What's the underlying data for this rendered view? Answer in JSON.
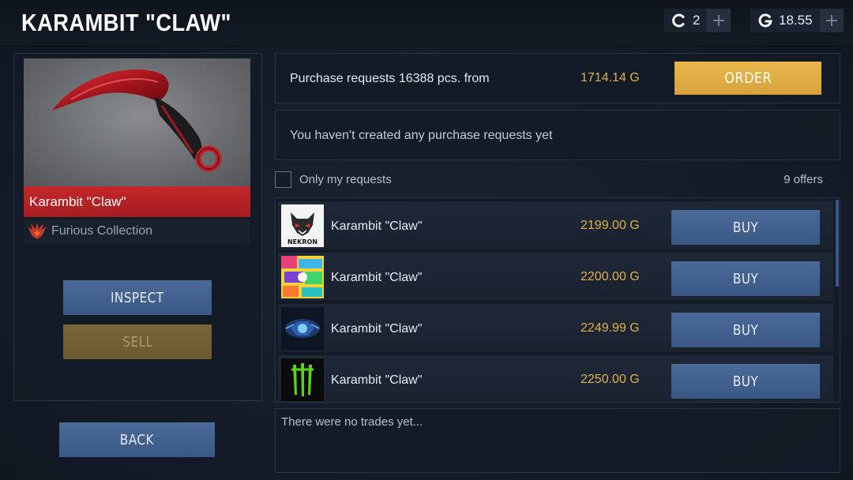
{
  "header": {
    "title": "KARAMBIT \"CLAW\"",
    "currencies": [
      {
        "icon": "coin-c-icon",
        "value": "2"
      },
      {
        "icon": "gold-g-icon",
        "value": "18.55"
      }
    ]
  },
  "item": {
    "name": "Karambit \"Claw\"",
    "collection": "Furious Collection"
  },
  "actions": {
    "inspect_label": "INSPECT",
    "sell_label": "SELL",
    "back_label": "BACK"
  },
  "order": {
    "text": "Purchase requests 16388 pcs. from",
    "price": "1714.14 G",
    "button_label": "ORDER"
  },
  "my_requests": {
    "empty_text": "You haven't created any purchase requests yet"
  },
  "filter": {
    "only_my_label": "Only my requests",
    "offers_count": "9 offers"
  },
  "offers": [
    {
      "thumb": "wolf-skull-avatar",
      "name": "Karambit \"Claw\"",
      "price": "2199.00 G",
      "buy_label": "BUY"
    },
    {
      "thumb": "sticker-bomb-avatar",
      "name": "Karambit \"Claw\"",
      "price": "2200.00 G",
      "buy_label": "BUY"
    },
    {
      "thumb": "blue-emblem-avatar",
      "name": "Karambit \"Claw\"",
      "price": "2249.99 G",
      "buy_label": "BUY"
    },
    {
      "thumb": "monster-claw-avatar",
      "name": "Karambit \"Claw\"",
      "price": "2250.00 G",
      "buy_label": "BUY"
    }
  ],
  "trades": {
    "empty_text": "There were no trades yet..."
  },
  "colors": {
    "gold": "#e0b04a",
    "button_blue": "#3b5884",
    "button_orange": "#e9b74c",
    "item_red": "#c3272a"
  }
}
